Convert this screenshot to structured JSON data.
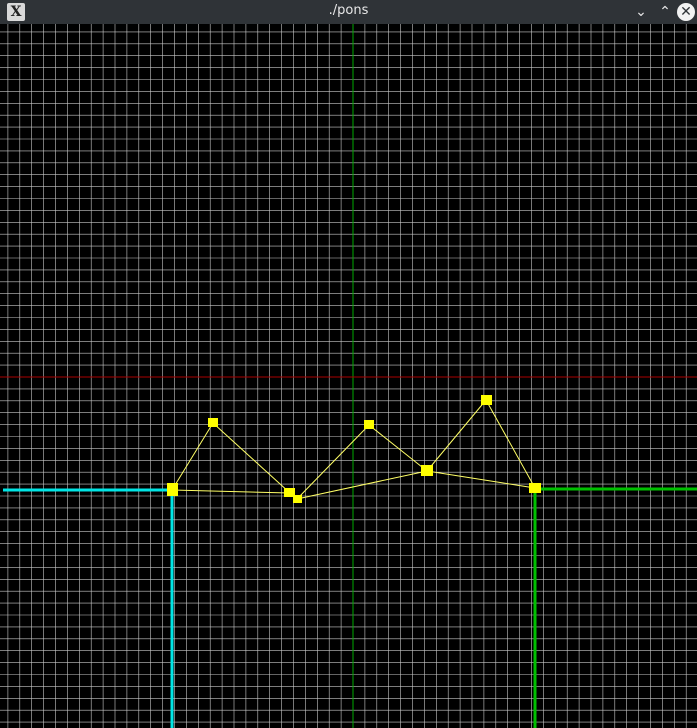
{
  "window": {
    "title": "./pons",
    "app_icon": "x-window-icon",
    "minimize_icon": "chevron-down-icon",
    "maximize_icon": "chevron-up-icon",
    "close_icon": "close-icon"
  },
  "canvas": {
    "background": "#000000",
    "grid_color": "#c8c8c8",
    "vertical_axis_color": "#00aa00",
    "horizontal_axis_color": "#aa0000",
    "left_anchor_color": "#00e5e5",
    "right_anchor_color": "#00c000",
    "node_color": "#ffff00",
    "link_color": "#ffff66"
  }
}
